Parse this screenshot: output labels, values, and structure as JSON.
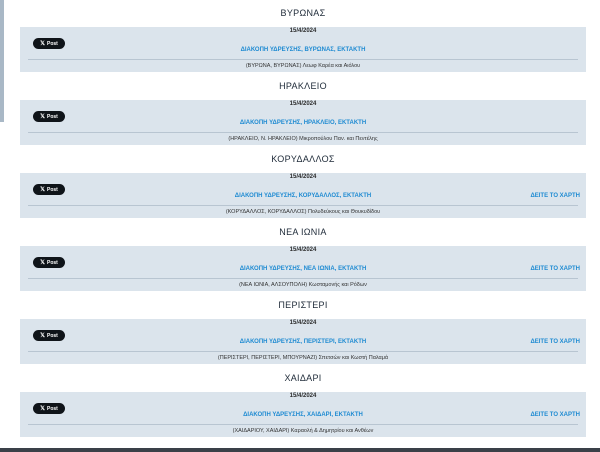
{
  "post_label": "Post",
  "map_label": "ΔΕΙΤΕ ΤΟ ΧΑΡΤΗ",
  "sections": [
    {
      "city": "ΒΥΡΩΝΑΣ",
      "date": "15/4/2024",
      "title": "ΔΙΑΚΟΠΗ ΥΔΡΕΥΣΗΣ, ΒΥΡΩΝΑΣ, ΕΚΤΑΚΤΗ",
      "map": "",
      "detail": "(ΒΥΡΩΝΑ, ΒΥΡΩΝΑΣ) Λεωφ Καρέα και Αιόλου"
    },
    {
      "city": "ΗΡΑΚΛΕΙΟ",
      "date": "15/4/2024",
      "title": "ΔΙΑΚΟΠΗ ΥΔΡΕΥΣΗΣ, ΗΡΑΚΛΕΙΟ, ΕΚΤΑΚΤΗ",
      "map": "",
      "detail": "(ΗΡΑΚΛΕΙΟ, Ν. ΗΡΑΚΛΕΙΟ) Μικροπούλου Παν. και Πεντέλης"
    },
    {
      "city": "ΚΟΡΥΔΑΛΛΟΣ",
      "date": "15/4/2024",
      "title": "ΔΙΑΚΟΠΗ ΥΔΡΕΥΣΗΣ, ΚΟΡΥΔΑΛΛΟΣ, ΕΚΤΑΚΤΗ",
      "map": "ΔΕΙΤΕ ΤΟ ΧΑΡΤΗ",
      "detail": "(ΚΟΡΥΔΑΛΛΟΣ, ΚΟΡΥΔΑΛΛΟΣ) Πολυδεύκους και Θουκυδίδου"
    },
    {
      "city": "ΝΕΑ ΙΩΝΙΑ",
      "date": "15/4/2024",
      "title": "ΔΙΑΚΟΠΗ ΥΔΡΕΥΣΗΣ, ΝΕΑ ΙΩΝΙΑ, ΕΚΤΑΚΤΗ",
      "map": "ΔΕΙΤΕ ΤΟ ΧΑΡΤΗ",
      "detail": "(ΝΕΑ ΙΩΝΙΑ, ΑΛΣΟΥΠΟΛΗ) Κωσταμονής και Ρόδων"
    },
    {
      "city": "ΠΕΡΙΣΤΕΡΙ",
      "date": "15/4/2024",
      "title": "ΔΙΑΚΟΠΗ ΥΔΡΕΥΣΗΣ, ΠΕΡΙΣΤΕΡΙ, ΕΚΤΑΚΤΗ",
      "map": "ΔΕΙΤΕ ΤΟ ΧΑΡΤΗ",
      "detail": "(ΠΕΡΙΣΤΕΡΙ, ΠΕΡΙΣΤΕΡΙ, ΜΠΟΥΡΝΑΖΙ) Σπετσών και Κωστή Παλαμά"
    },
    {
      "city": "ΧΑΙΔΑΡΙ",
      "date": "15/4/2024",
      "title": "ΔΙΑΚΟΠΗ ΥΔΡΕΥΣΗΣ, ΧΑΙΔΑΡΙ, ΕΚΤΑΚΤΗ",
      "map": "ΔΕΙΤΕ ΤΟ ΧΑΡΤΗ",
      "detail": "(ΧΑΙΔΑΡΙΟΥ, ΧΑΙΔΑΡΙ) Καραολή & Δημητρίου και Ανθέων"
    }
  ]
}
